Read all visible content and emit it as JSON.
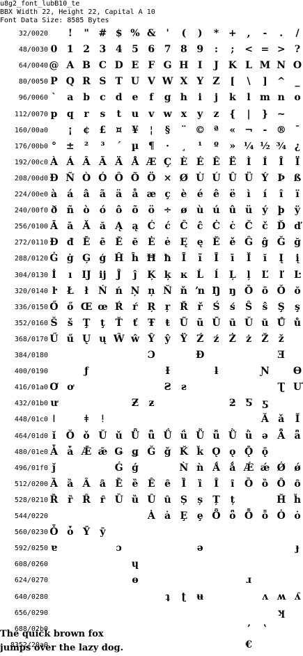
{
  "header": {
    "line1": "u8g2_font_lubB10_te",
    "line2": "BBX Width 22, Height 22, Capital A 10",
    "line3": "Font Data Size: 8585 Bytes"
  },
  "rows": [
    {
      "label": "32/0020",
      "glyphs": [
        "",
        "!",
        "\"",
        "#",
        "$",
        "%",
        "&",
        "'",
        "(",
        ")",
        "*",
        "+",
        ",",
        "-",
        ".",
        "/"
      ]
    },
    {
      "label": "48/0030",
      "glyphs": [
        "0",
        "1",
        "2",
        "3",
        "4",
        "5",
        "6",
        "7",
        "8",
        "9",
        ":",
        ";",
        "<",
        "=",
        ">",
        "?"
      ]
    },
    {
      "label": "64/0040",
      "glyphs": [
        "@",
        "A",
        "B",
        "C",
        "D",
        "E",
        "F",
        "G",
        "H",
        "I",
        "J",
        "K",
        "L",
        "M",
        "N",
        "O"
      ]
    },
    {
      "label": "80/0050",
      "glyphs": [
        "P",
        "Q",
        "R",
        "S",
        "T",
        "U",
        "V",
        "W",
        "X",
        "Y",
        "Z",
        "[",
        "\\",
        "]",
        "^",
        "_"
      ]
    },
    {
      "label": "96/0060",
      "glyphs": [
        "`",
        "a",
        "b",
        "c",
        "d",
        "e",
        "f",
        "g",
        "h",
        "i",
        "j",
        "k",
        "l",
        "m",
        "n",
        "o"
      ]
    },
    {
      "label": "112/0070",
      "glyphs": [
        "p",
        "q",
        "r",
        "s",
        "t",
        "u",
        "v",
        "w",
        "x",
        "y",
        "z",
        "{",
        "|",
        "}",
        "~",
        ""
      ]
    },
    {
      "label": "160/00a0",
      "glyphs": [
        "",
        "¡",
        "¢",
        "£",
        "¤",
        "¥",
        "¦",
        "§",
        "¨",
        "©",
        "ª",
        "«",
        "¬",
        "-",
        "®",
        "¯"
      ]
    },
    {
      "label": "176/00b0",
      "glyphs": [
        "°",
        "±",
        "²",
        "³",
        "´",
        "µ",
        "¶",
        "·",
        "¸",
        "¹",
        "º",
        "»",
        "¼",
        "½",
        "¾",
        "¿"
      ]
    },
    {
      "label": "192/00c0",
      "glyphs": [
        "À",
        "Á",
        "Â",
        "Ã",
        "Ä",
        "Å",
        "Æ",
        "Ç",
        "È",
        "É",
        "Ê",
        "Ë",
        "Ì",
        "Í",
        "Î",
        "Ï"
      ]
    },
    {
      "label": "208/00d0",
      "glyphs": [
        "Ð",
        "Ñ",
        "Ò",
        "Ó",
        "Ô",
        "Õ",
        "Ö",
        "×",
        "Ø",
        "Ù",
        "Ú",
        "Û",
        "Ü",
        "Ý",
        "Þ",
        "ß"
      ]
    },
    {
      "label": "224/00e0",
      "glyphs": [
        "à",
        "á",
        "â",
        "ã",
        "ä",
        "å",
        "æ",
        "ç",
        "è",
        "é",
        "ê",
        "ë",
        "ì",
        "í",
        "î",
        "ï"
      ]
    },
    {
      "label": "240/00f0",
      "glyphs": [
        "ð",
        "ñ",
        "ò",
        "ó",
        "ô",
        "õ",
        "ö",
        "÷",
        "ø",
        "ù",
        "ú",
        "û",
        "ü",
        "ý",
        "þ",
        "ÿ"
      ]
    },
    {
      "label": "256/0100",
      "glyphs": [
        "Ā",
        "ā",
        "Ă",
        "ă",
        "Ą",
        "ą",
        "Ć",
        "ć",
        "Ĉ",
        "ĉ",
        "Ċ",
        "ċ",
        "Č",
        "č",
        "Ď",
        "ď"
      ]
    },
    {
      "label": "272/0110",
      "glyphs": [
        "Đ",
        "đ",
        "Ē",
        "ē",
        "Ĕ",
        "ĕ",
        "Ė",
        "ė",
        "Ę",
        "ę",
        "Ě",
        "ě",
        "Ĝ",
        "ĝ",
        "Ğ",
        "ğ"
      ]
    },
    {
      "label": "288/0120",
      "glyphs": [
        "Ġ",
        "ġ",
        "Ģ",
        "ģ",
        "Ĥ",
        "ĥ",
        "Ħ",
        "ħ",
        "Ĩ",
        "ĩ",
        "Ī",
        "ī",
        "Ĭ",
        "ĭ",
        "Į",
        "į"
      ]
    },
    {
      "label": "304/0130",
      "glyphs": [
        "İ",
        "ı",
        "Ĳ",
        "ĳ",
        "Ĵ",
        "ĵ",
        "Ķ",
        "ķ",
        "ĸ",
        "Ĺ",
        "ĺ",
        "Ļ",
        "ļ",
        "Ľ",
        "ľ",
        "Ŀ"
      ]
    },
    {
      "label": "320/0140",
      "glyphs": [
        "ŀ",
        "Ł",
        "ł",
        "Ń",
        "ń",
        "Ņ",
        "ņ",
        "Ň",
        "ň",
        "ŉ",
        "Ŋ",
        "ŋ",
        "Ō",
        "ō",
        "Ŏ",
        "ŏ"
      ]
    },
    {
      "label": "336/0150",
      "glyphs": [
        "Ő",
        "ő",
        "Œ",
        "œ",
        "Ŕ",
        "ŕ",
        "Ŗ",
        "ŗ",
        "Ř",
        "ř",
        "Ś",
        "ś",
        "Ŝ",
        "ŝ",
        "Ş",
        "ş"
      ]
    },
    {
      "label": "352/0160",
      "glyphs": [
        "Š",
        "š",
        "Ţ",
        "ţ",
        "Ť",
        "ť",
        "Ŧ",
        "ŧ",
        "Ũ",
        "ũ",
        "Ū",
        "ū",
        "Ŭ",
        "ŭ",
        "Ů",
        "ů"
      ]
    },
    {
      "label": "368/0170",
      "glyphs": [
        "Ű",
        "ű",
        "Ų",
        "ų",
        "Ŵ",
        "ŵ",
        "Ŷ",
        "ŷ",
        "Ÿ",
        "Ź",
        "ź",
        "Ż",
        "ż",
        "Ž",
        "ž",
        ""
      ]
    },
    {
      "label": "384/0180",
      "glyphs": [
        "",
        "",
        "",
        "",
        "",
        "",
        "Ɔ",
        "",
        "",
        "Ɖ",
        "",
        "",
        "",
        "",
        "Ǝ",
        ""
      ]
    },
    {
      "label": "400/0190",
      "glyphs": [
        "",
        "",
        "ƒ",
        "",
        "",
        "",
        "",
        "Ɨ",
        "",
        "",
        "ƚ",
        "",
        "",
        "Ɲ",
        "",
        "Ɵ"
      ]
    },
    {
      "label": "416/01a0",
      "glyphs": [
        "Ơ",
        "ơ",
        "",
        "",
        "",
        "",
        "",
        "Ƨ",
        "ƨ",
        "",
        "",
        "",
        "",
        "",
        "Ʈ",
        "Ư"
      ]
    },
    {
      "label": "432/01b0",
      "glyphs": [
        "ư",
        "",
        "",
        "",
        "",
        "Ƶ",
        "ƶ",
        "",
        "",
        "",
        "",
        "ƻ",
        "Ƽ",
        "ƽ",
        "",
        ""
      ]
    },
    {
      "label": "448/01c0",
      "glyphs": [
        "ǀ",
        "",
        "ǂ",
        "ǃ",
        "",
        "",
        "",
        "",
        "",
        "",
        "",
        "",
        "",
        "Ǎ",
        "ǎ",
        "Ǐ"
      ]
    },
    {
      "label": "464/01d0",
      "glyphs": [
        "ǐ",
        "Ǒ",
        "ǒ",
        "Ǔ",
        "ǔ",
        "Ǖ",
        "ǖ",
        "Ǘ",
        "ǘ",
        "Ǚ",
        "ǚ",
        "Ǜ",
        "ǜ",
        "ǝ",
        "Ǟ",
        "ǟ"
      ]
    },
    {
      "label": "480/01e0",
      "glyphs": [
        "Ǡ",
        "ǡ",
        "Ǣ",
        "ǣ",
        "Ǥ",
        "ǥ",
        "Ǧ",
        "ǧ",
        "Ǩ",
        "ǩ",
        "Ǫ",
        "ǫ",
        "Ǭ",
        "ǭ",
        "",
        ""
      ]
    },
    {
      "label": "496/01f0",
      "glyphs": [
        "ǰ",
        "",
        "",
        "",
        "Ǵ",
        "ǵ",
        "",
        "",
        "Ǹ",
        "ǹ",
        "Ǻ",
        "ǻ",
        "Ǽ",
        "ǽ",
        "Ǿ",
        "ǿ"
      ]
    },
    {
      "label": "512/0200",
      "glyphs": [
        "Ȁ",
        "ȁ",
        "Ȃ",
        "ȃ",
        "Ȅ",
        "ȅ",
        "Ȇ",
        "ȇ",
        "Ȉ",
        "ȉ",
        "Ȋ",
        "ȋ",
        "Ȍ",
        "ȍ",
        "Ȏ",
        "ȏ"
      ]
    },
    {
      "label": "528/0210",
      "glyphs": [
        "Ȑ",
        "ȑ",
        "Ȓ",
        "ȓ",
        "Ȕ",
        "ȕ",
        "Ȗ",
        "ȗ",
        "Ș",
        "ș",
        "Ț",
        "ț",
        "",
        "",
        "Ȟ",
        "ȟ"
      ]
    },
    {
      "label": "544/0220",
      "glyphs": [
        "",
        "",
        "",
        "",
        "",
        "",
        "Ȧ",
        "ȧ",
        "Ȩ",
        "ȩ",
        "Ȫ",
        "ȫ",
        "Ȭ",
        "ȭ",
        "Ȯ",
        "ȯ"
      ]
    },
    {
      "label": "560/0230",
      "glyphs": [
        "Ȱ",
        "ȱ",
        "Ȳ",
        "ȳ",
        "",
        "",
        "",
        "",
        "",
        "",
        "",
        "",
        "",
        "",
        "",
        ""
      ]
    },
    {
      "label": "592/0250",
      "glyphs": [
        "ɐ",
        "",
        "",
        "",
        "ɔ",
        "",
        "",
        "",
        "",
        "ə",
        "",
        "",
        "",
        "",
        "",
        "ɟ"
      ]
    },
    {
      "label": "608/0260",
      "glyphs": [
        "",
        "",
        "",
        "",
        "",
        "ɥ",
        "",
        "",
        "",
        "",
        "",
        "",
        "",
        "",
        "",
        ""
      ]
    },
    {
      "label": "624/0270",
      "glyphs": [
        "",
        "",
        "",
        "",
        "",
        "ɵ",
        "",
        "",
        "",
        "",
        "",
        "",
        "ɹ",
        "",
        "",
        ""
      ]
    },
    {
      "label": "640/0280",
      "glyphs": [
        "",
        "",
        "",
        "",
        "",
        "",
        "",
        "ʇ",
        "ʈ",
        "ʉ",
        "",
        "",
        "",
        "ʌ",
        "ʍ",
        "ʎ"
      ]
    },
    {
      "label": "656/0290",
      "glyphs": [
        "",
        "",
        "",
        "",
        "",
        "",
        "",
        "",
        "",
        "",
        "",
        "",
        "",
        "",
        "ʞ",
        ""
      ]
    },
    {
      "label": "688/02b0",
      "glyphs": [
        "",
        "",
        "",
        "",
        "",
        "",
        "",
        "",
        "",
        "",
        "",
        "",
        "ʼ",
        "ʽ",
        "",
        ""
      ]
    },
    {
      "label": "8352/20a0",
      "glyphs": [
        "",
        "",
        "",
        "",
        "",
        "",
        "",
        "",
        "",
        "",
        "",
        "",
        "€",
        "",
        "",
        ""
      ]
    }
  ],
  "sample": {
    "line1": "The quick brown fox",
    "line2": "jumps over the lazy dog."
  }
}
